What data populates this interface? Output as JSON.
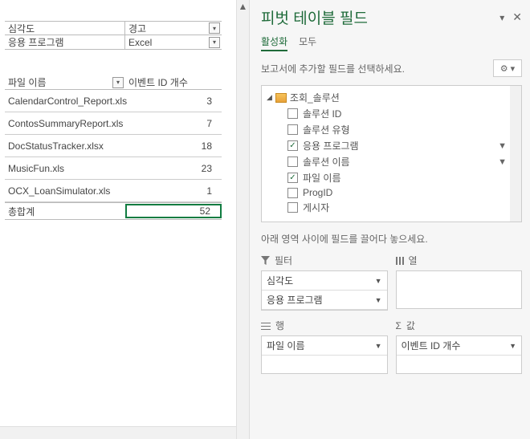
{
  "filters": [
    {
      "label": "심각도",
      "value": "경고"
    },
    {
      "label": "응용 프로그램",
      "value": "Excel"
    }
  ],
  "pivot": {
    "rowHeader": "파일 이름",
    "valHeader": "이벤트 ID 개수",
    "rows": [
      {
        "name": "CalendarControl_Report.xls",
        "count": 3
      },
      {
        "name": "ContosSummaryReport.xls",
        "count": 7
      },
      {
        "name": "DocStatusTracker.xlsx",
        "count": 18
      },
      {
        "name": "MusicFun.xls",
        "count": 23
      },
      {
        "name": "OCX_LoanSimulator.xls",
        "count": 1
      }
    ],
    "totalLabel": "총합계",
    "totalValue": 52
  },
  "pane": {
    "title": "피벗 테이블 필드",
    "tabs": {
      "active": "활성화",
      "all": "모두"
    },
    "hint": "보고서에 추가할 필드를 선택하세요.",
    "tree": {
      "root": "조회_솔루션",
      "fields": [
        {
          "label": "솔루션 ID",
          "checked": false,
          "filter": false
        },
        {
          "label": "솔루션 유형",
          "checked": false,
          "filter": false
        },
        {
          "label": "응용 프로그램",
          "checked": true,
          "filter": true
        },
        {
          "label": "솔루션 이름",
          "checked": false,
          "filter": true,
          "plus": true
        },
        {
          "label": "파일 이름",
          "checked": true,
          "filter": false
        },
        {
          "label": "ProgID",
          "checked": false,
          "filter": false
        },
        {
          "label": "게시자",
          "checked": false,
          "filter": false
        }
      ]
    },
    "dragHint": "아래 영역 사이에 필드를 끌어다 놓으세요.",
    "areas": {
      "filters": {
        "label": "필터",
        "items": [
          "심각도",
          "응용 프로그램"
        ]
      },
      "columns": {
        "label": "열",
        "items": []
      },
      "rows": {
        "label": "행",
        "items": [
          "파일 이름"
        ]
      },
      "values": {
        "label": "값",
        "items": [
          "이벤트 ID 개수"
        ]
      }
    }
  }
}
